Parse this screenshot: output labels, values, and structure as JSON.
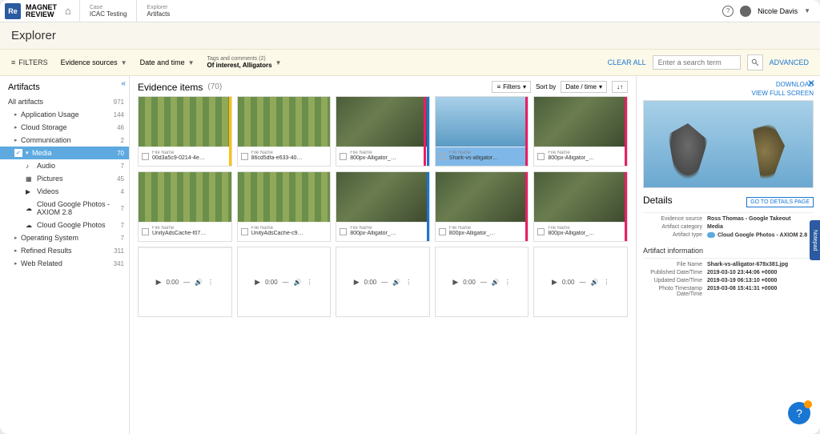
{
  "header": {
    "logo_short": "Re",
    "logo1": "MAGNET",
    "logo2": "REVIEW",
    "case_label": "Case",
    "case_value": "ICAC Testing",
    "explorer_label": "Explorer",
    "explorer_value": "Artifacts",
    "user_name": "Nicole Davis"
  },
  "title": "Explorer",
  "filters": {
    "filters_label": "FILTERS",
    "evidence_sources": "Evidence sources",
    "date_time": "Date and time",
    "tags_label": "Tags and comments (2)",
    "tags_value": "Of interest, Alligators",
    "clear_all": "CLEAR ALL",
    "search_placeholder": "Enter a search term",
    "advanced": "ADVANCED"
  },
  "sidebar": {
    "title": "Artifacts",
    "all_label": "All artifacts",
    "all_count": "971",
    "items": [
      {
        "label": "Application Usage",
        "count": "144"
      },
      {
        "label": "Cloud Storage",
        "count": "46"
      },
      {
        "label": "Communication",
        "count": "2"
      },
      {
        "label": "Media",
        "count": "70"
      },
      {
        "label": "Operating System",
        "count": "7"
      },
      {
        "label": "Refined Results",
        "count": "311"
      },
      {
        "label": "Web Related",
        "count": "341"
      }
    ],
    "media_children": [
      {
        "label": "Audio",
        "count": "7"
      },
      {
        "label": "Pictures",
        "count": "45"
      },
      {
        "label": "Videos",
        "count": "4"
      },
      {
        "label": "Cloud Google Photos - AXIOM 2.8",
        "count": "7"
      },
      {
        "label": "Cloud Google Photos",
        "count": "7"
      }
    ]
  },
  "grid": {
    "title": "Evidence items",
    "count": "(70)",
    "filters_btn": "Filters",
    "sort_label": "Sort by",
    "sort_value": "Date / time",
    "file_name_label": "File Name",
    "items": [
      {
        "fn": "00d3a5c9-0214-4e…"
      },
      {
        "fn": "86cd5dfa-e633-40…"
      },
      {
        "fn": "800px-Alligator_…"
      },
      {
        "fn": "Shark-vs-alligator…"
      },
      {
        "fn": "800px-Alligator_…"
      },
      {
        "fn": "UnityAdsCache-f07…"
      },
      {
        "fn": "UnityAdsCache-c9…"
      },
      {
        "fn": "800px-Alligator_…"
      },
      {
        "fn": "800px-Alligator_…"
      },
      {
        "fn": "800px-Alligator_…"
      }
    ],
    "audio_time": "0:00"
  },
  "details": {
    "download": "DOWNLOAD",
    "fullscreen": "VIEW FULL SCREEN",
    "title": "Details",
    "go_btn": "GO TO DETAILS PAGE",
    "rows": [
      {
        "label": "Evidence source",
        "value": "Ross Thomas - Google Takeout"
      },
      {
        "label": "Artifact category",
        "value": "Media"
      },
      {
        "label": "Artifact type",
        "value": "Cloud Google Photos - AXIOM 2.8"
      }
    ],
    "info_title": "Artifact information",
    "info_rows": [
      {
        "label": "File Name",
        "value": "Shark-vs-alligator-678x381.jpg"
      },
      {
        "label": "Published Date/Time",
        "value": "2019-03-10 23:44:06 +0000"
      },
      {
        "label": "Updated Date/Time",
        "value": "2019-03-19 06:13:10 +0000"
      },
      {
        "label": "Photo Timestamp Date/Time",
        "value": "2019-03-08 15:41:31 +0000"
      }
    ]
  },
  "notepad": "Notepad"
}
